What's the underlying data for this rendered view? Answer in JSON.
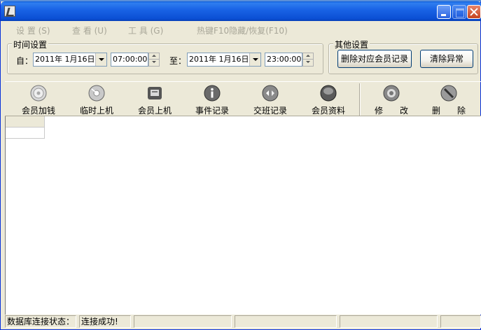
{
  "menu": {
    "settings": "设 置 (S)",
    "view": "查 看 (U)",
    "tools": "工 具 (G)",
    "hotkey": "热键F10隐藏/恢复(F10)"
  },
  "time_settings": {
    "group_label": "时间设置",
    "from_label": "自：",
    "from_date": "2011年 1月16日",
    "from_time": "07:00:00",
    "to_label": "至：",
    "to_date": "2011年 1月16日",
    "to_time": "23:00:00"
  },
  "other_settings": {
    "group_label": "其他设置",
    "delete_member_records": "删除对应会员记录",
    "clear_exceptions": "清除异常"
  },
  "toolbar": {
    "items": [
      {
        "label": "会员加钱",
        "icon": "disc-icon"
      },
      {
        "label": "临时上机",
        "icon": "cd-icon"
      },
      {
        "label": "会员上机",
        "icon": "card-icon"
      },
      {
        "label": "事件记录",
        "icon": "info-icon"
      },
      {
        "label": "交班记录",
        "icon": "handover-icon"
      },
      {
        "label": "会员资料",
        "icon": "profile-icon"
      },
      {
        "label": "修　　改",
        "icon": "edit-icon"
      },
      {
        "label": "删　　除",
        "icon": "delete-icon"
      }
    ]
  },
  "status": {
    "db_label": "数据库连接状态：",
    "db_value": "连接成功!"
  }
}
